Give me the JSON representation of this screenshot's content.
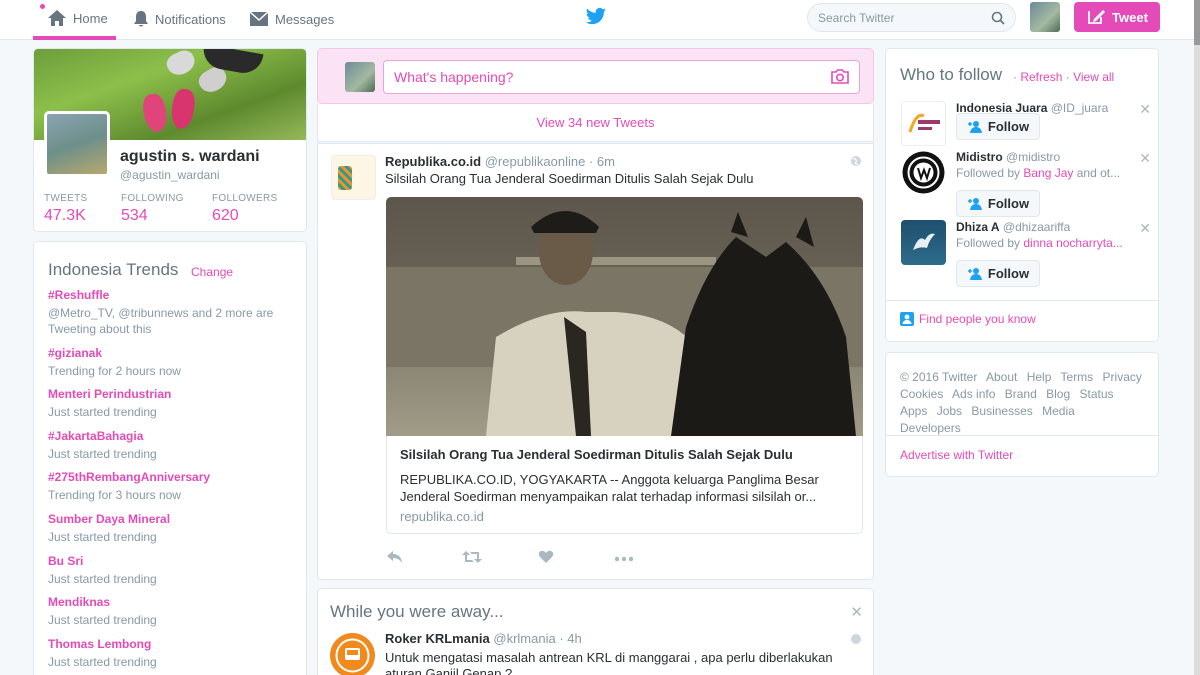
{
  "nav": {
    "home": "Home",
    "notifications": "Notifications",
    "messages": "Messages",
    "search_placeholder": "Search Twitter",
    "tweet_button": "Tweet"
  },
  "profile": {
    "name": "agustin s. wardani",
    "handle": "@agustin_wardani",
    "stats": [
      {
        "label": "TWEETS",
        "value": "47.3K"
      },
      {
        "label": "FOLLOWING",
        "value": "534"
      },
      {
        "label": "FOLLOWERS",
        "value": "620"
      }
    ]
  },
  "trends": {
    "title": "Indonesia Trends",
    "change": "Change",
    "items": [
      {
        "topic": "#Reshuffle",
        "subtitle": "@Metro_TV, @tribunnews and 2 more are Tweeting about this"
      },
      {
        "topic": "#gizianak",
        "subtitle": "Trending for 2 hours now"
      },
      {
        "topic": "Menteri Perindustrian",
        "subtitle": "Just started trending"
      },
      {
        "topic": "#JakartaBahagia",
        "subtitle": "Just started trending"
      },
      {
        "topic": "#275thRembangAnniversary",
        "subtitle": "Trending for 3 hours now"
      },
      {
        "topic": "Sumber Daya Mineral",
        "subtitle": "Just started trending"
      },
      {
        "topic": "Bu Sri",
        "subtitle": "Just started trending"
      },
      {
        "topic": "Mendiknas",
        "subtitle": "Just started trending"
      },
      {
        "topic": "Thomas Lembong",
        "subtitle": "Just started trending"
      }
    ]
  },
  "compose": {
    "placeholder": "What's happening?"
  },
  "new_tweets": "View 34 new Tweets",
  "tweet": {
    "name": "Republika.co.id",
    "handle": "@republikaonline",
    "time": "· 6m",
    "text": "Silsilah Orang Tua Jenderal Soedirman Ditulis Salah Sejak Dulu",
    "card_title": "Silsilah Orang Tua Jenderal Soedirman Ditulis Salah Sejak Dulu",
    "card_desc": "REPUBLIKA.CO.ID, YOGYAKARTA -- Anggota keluarga Panglima Besar Jenderal Soedirman menyampaikan ralat terhadap informasi silsilah or...",
    "card_url": "republika.co.id"
  },
  "away": {
    "title": "While you were away...",
    "name": "Roker KRLmania",
    "handle": "@krlmania",
    "time": "· 4h",
    "text": "Untuk mengatasi masalah antrean KRL di manggarai , apa perlu diberlakukan aturan Ganjil Genap ?"
  },
  "who_to_follow": {
    "title": "Who to follow",
    "refresh": "Refresh",
    "sep": "·",
    "view_all": "View all",
    "follow_label": "Follow",
    "users": [
      {
        "name": "Indonesia Juara",
        "handle": "@ID_juara",
        "followed_prefix": "",
        "followed_by": "",
        "followed_rest": ""
      },
      {
        "name": "Midistro",
        "handle": "@midistro",
        "followed_prefix": "Followed by ",
        "followed_by": "Bang Jay",
        "followed_rest": " and ot..."
      },
      {
        "name": "Dhiza A",
        "handle": "@dhizaariffa",
        "followed_prefix": "Followed by ",
        "followed_by": "dinna nocharryta...",
        "followed_rest": ""
      }
    ],
    "find_people": "Find people you know"
  },
  "footer": {
    "links": [
      "© 2016 Twitter",
      "About",
      "Help",
      "Terms",
      "Privacy",
      "Cookies",
      "Ads info",
      "Brand",
      "Blog",
      "Status",
      "Apps",
      "Jobs",
      "Businesses",
      "Media",
      "Developers"
    ],
    "advertise": "Advertise with Twitter"
  },
  "colors": {
    "accent": "#e44bb8",
    "twitter_blue": "#1da1f2"
  }
}
